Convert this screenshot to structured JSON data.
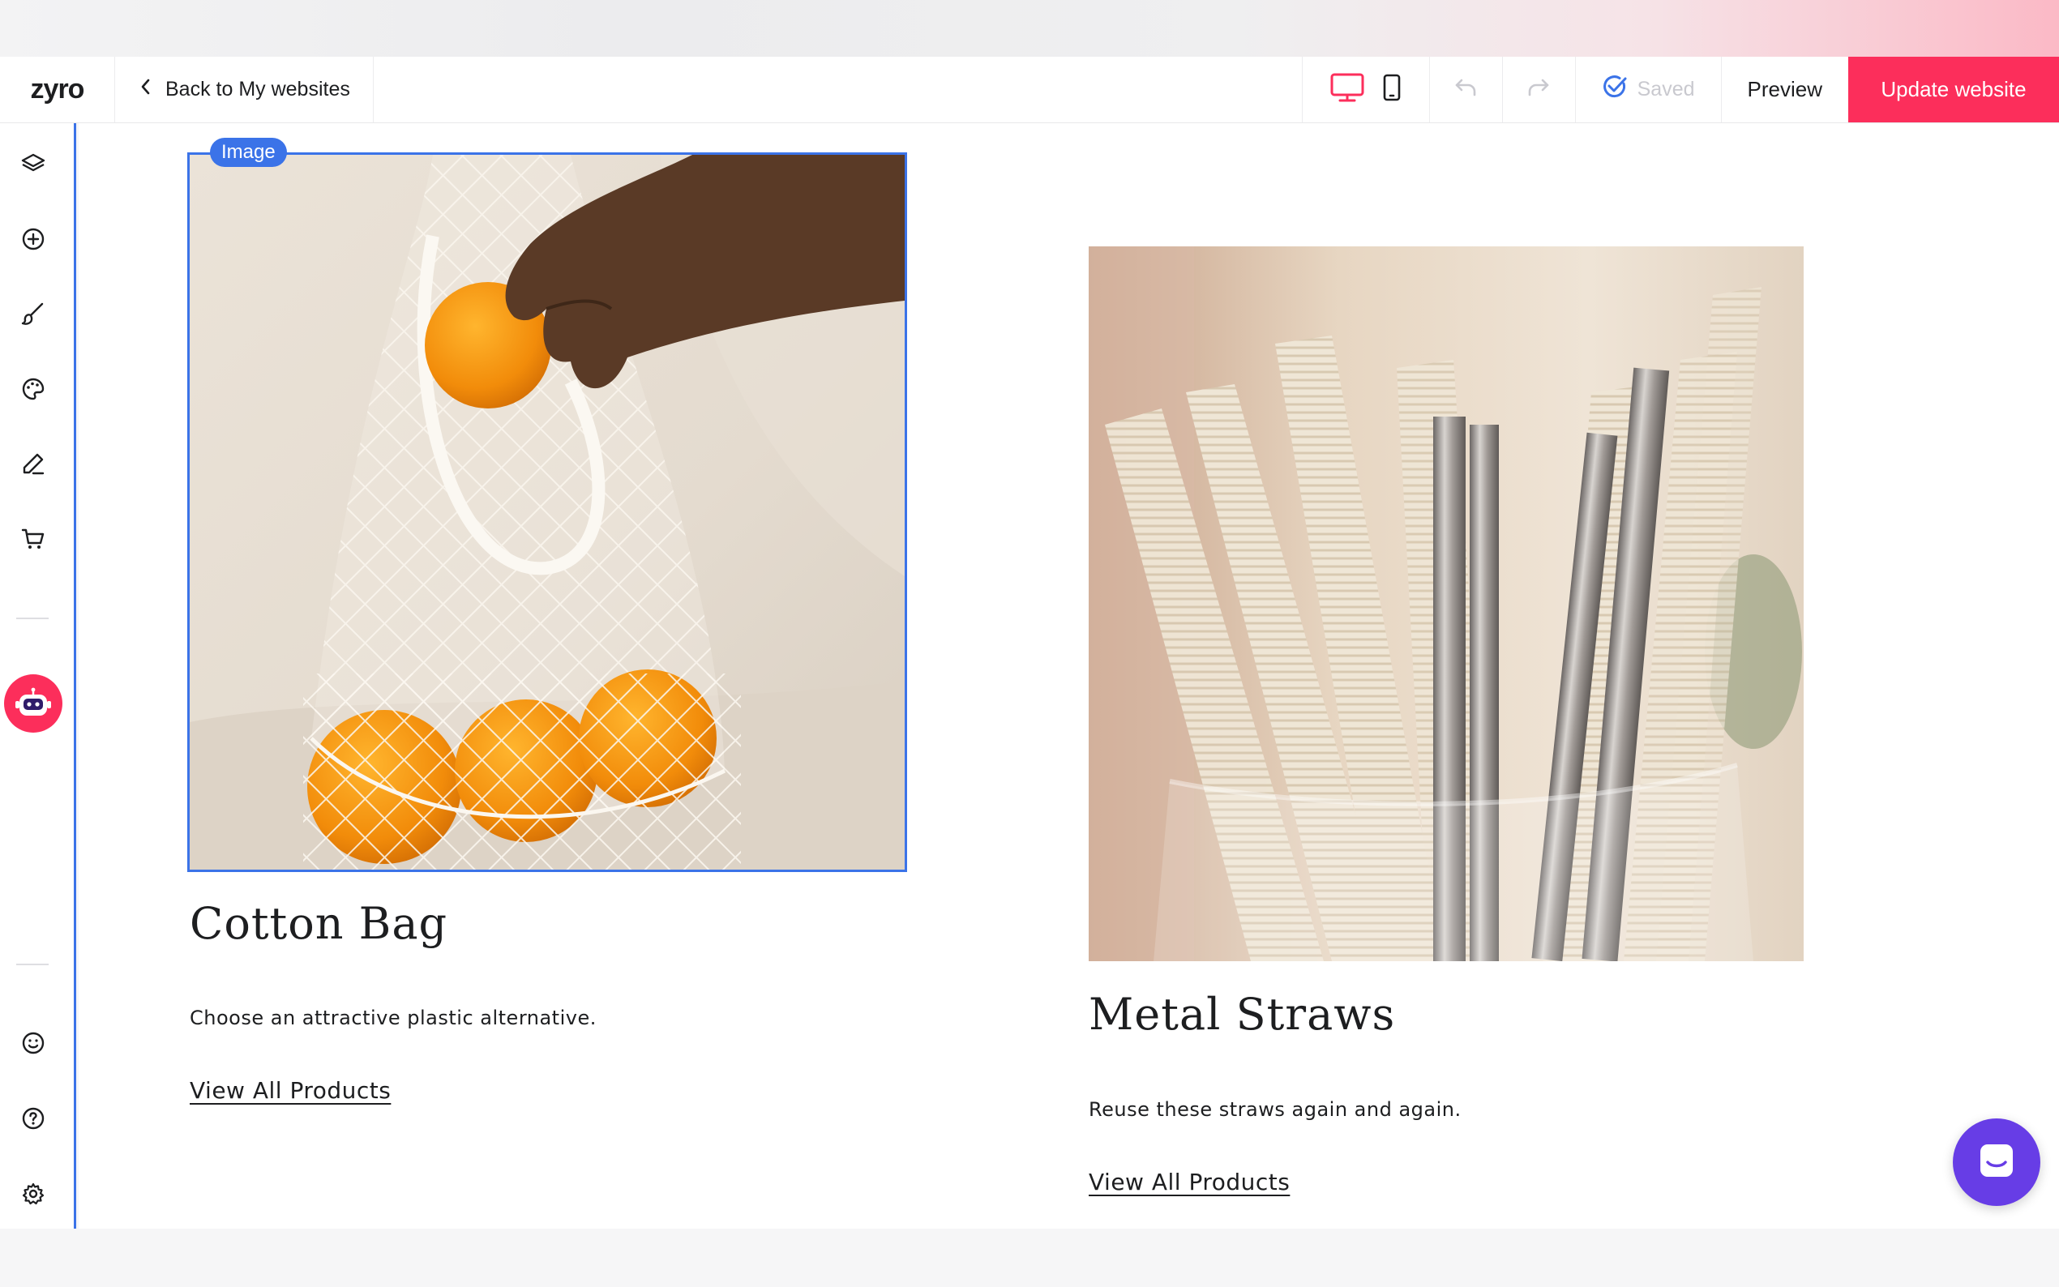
{
  "app": {
    "logo_text": "zyro",
    "accent_color": "#fc2e5b",
    "selection_color": "#3b73e8"
  },
  "header": {
    "back_label": "Back to My websites",
    "saved_label": "Saved",
    "preview_label": "Preview",
    "update_label": "Update website"
  },
  "sidebar": {
    "items": [
      {
        "icon": "layers-icon"
      },
      {
        "icon": "add-circle-icon"
      },
      {
        "icon": "brush-icon"
      },
      {
        "icon": "palette-icon"
      },
      {
        "icon": "pen-icon"
      },
      {
        "icon": "cart-icon"
      },
      {
        "icon": "ai-robot-icon"
      },
      {
        "icon": "smiley-icon"
      },
      {
        "icon": "help-icon"
      },
      {
        "icon": "settings-icon"
      }
    ]
  },
  "canvas": {
    "selected_tag": "Image",
    "cards": [
      {
        "title": "Cotton Bag",
        "description": "Choose an attractive plastic alternative.",
        "link": "View All Products"
      },
      {
        "title": "Metal Straws",
        "description": "Reuse these straws again and again.",
        "link": "View All Products"
      }
    ]
  }
}
